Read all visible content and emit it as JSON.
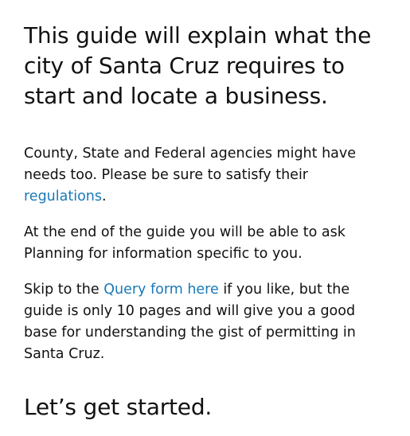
{
  "guide": {
    "headline": "This guide will explain what the city of Santa Cruz requires to start and locate a business.",
    "agencies_text_before": "County, State and Federal agencies might have needs too. Please be sure to satisfy their ",
    "regulations_link": "regulations",
    "agencies_text_after": ".",
    "end_of_guide_text": "At the end of the guide you will be able to ask Planning for information specific to you.",
    "skip_text_before": "Skip to the ",
    "query_form_link": "Query form here",
    "skip_text_after": " if you like, but the guide is only 10 pages and will give you a good base for understanding the gist of permitting in Santa Cruz.",
    "closing": "Let’s get started."
  },
  "colors": {
    "text": "#111111",
    "link": "#1a79b8",
    "background": "#ffffff"
  }
}
